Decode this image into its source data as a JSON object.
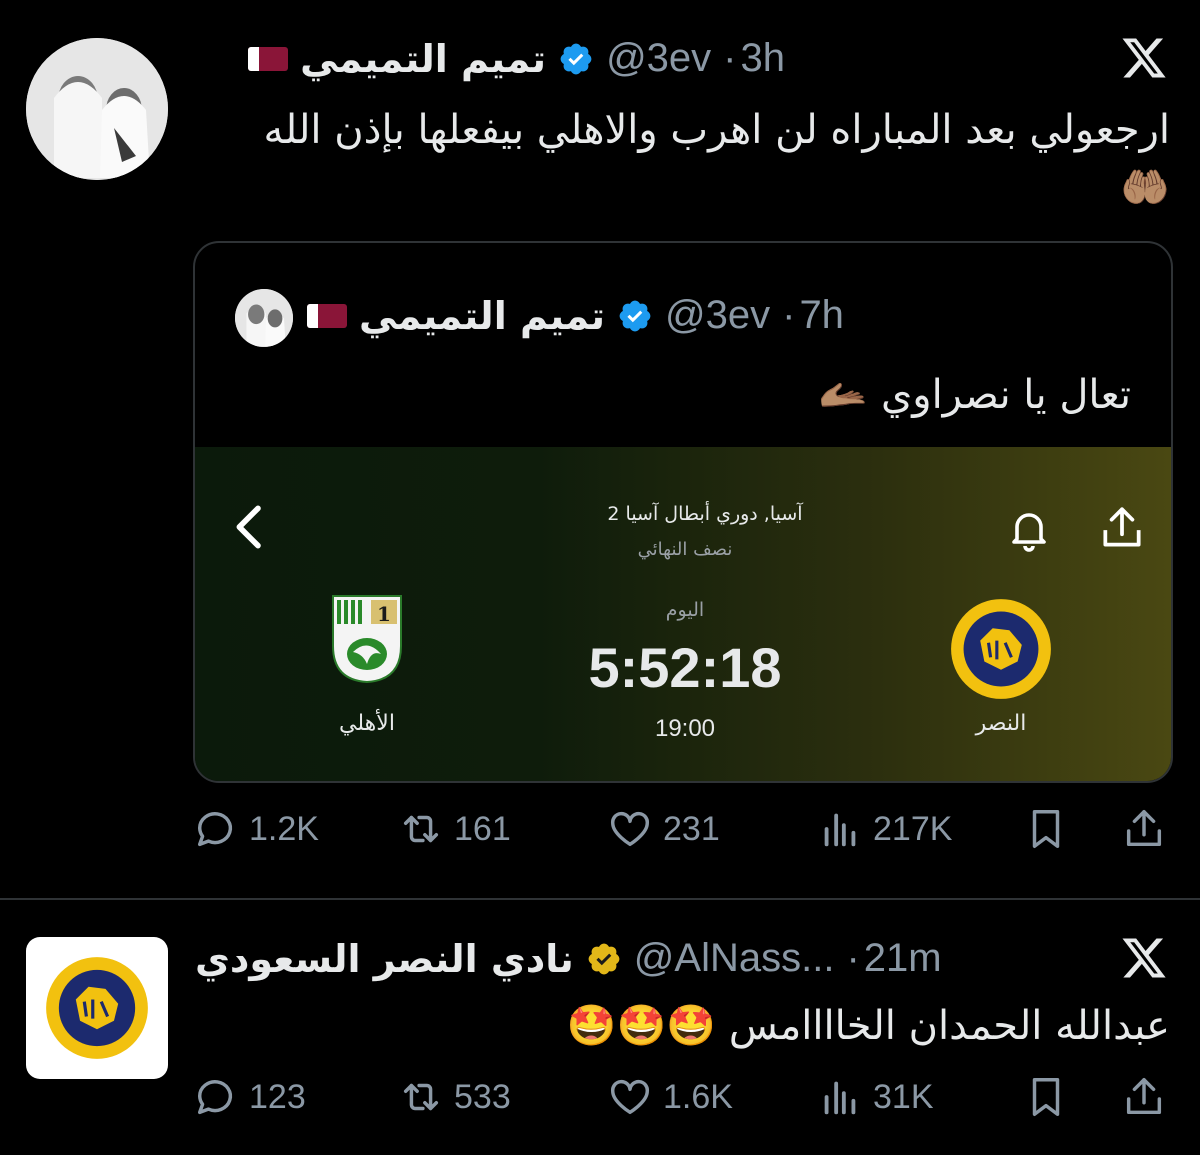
{
  "tweet1": {
    "display_name": "تميم التميمي",
    "handle": "@3ev",
    "time": "3h",
    "text_line1": "ارجعولي بعد المباراه لن اهرب والاهلي بيفعلها بإذن الله",
    "text_line2": "🤲🏽",
    "quote": {
      "display_name": "تميم التميمي",
      "handle": "@3ev",
      "time": "7h",
      "text": "تعال يا نصراوي 🫴🏽",
      "match_card": {
        "competition": "آسيا, دوري أبطال آسيا 2",
        "stage": "نصف النهائي",
        "day_label": "اليوم",
        "countdown": "5:52:18",
        "kickoff": "19:00",
        "home_team": "النصر",
        "away_team": "الأهلي"
      }
    },
    "actions": {
      "replies": "1.2K",
      "reposts": "161",
      "likes": "231",
      "views": "217K"
    }
  },
  "tweet2": {
    "display_name": "نادي النصر السعودي",
    "handle": "@AlNass...",
    "time": "21m",
    "text": "عبدالله الحمدان الخاااامس 🤩🤩🤩",
    "actions": {
      "replies": "123",
      "reposts": "533",
      "likes": "1.6K",
      "views": "31K"
    }
  },
  "colors": {
    "background": "#000000",
    "text": "#e7e9ea",
    "muted": "#8b98a5",
    "verified_blue": "#1d9bf0",
    "verified_gold": "#e2b719",
    "border": "#2f3336"
  },
  "icons": [
    "x-logo-icon",
    "verified-badge-icon",
    "qatar-flag-icon",
    "reply-icon",
    "repost-icon",
    "like-icon",
    "views-icon",
    "bookmark-icon",
    "share-icon",
    "back-chevron-icon",
    "bell-icon"
  ]
}
